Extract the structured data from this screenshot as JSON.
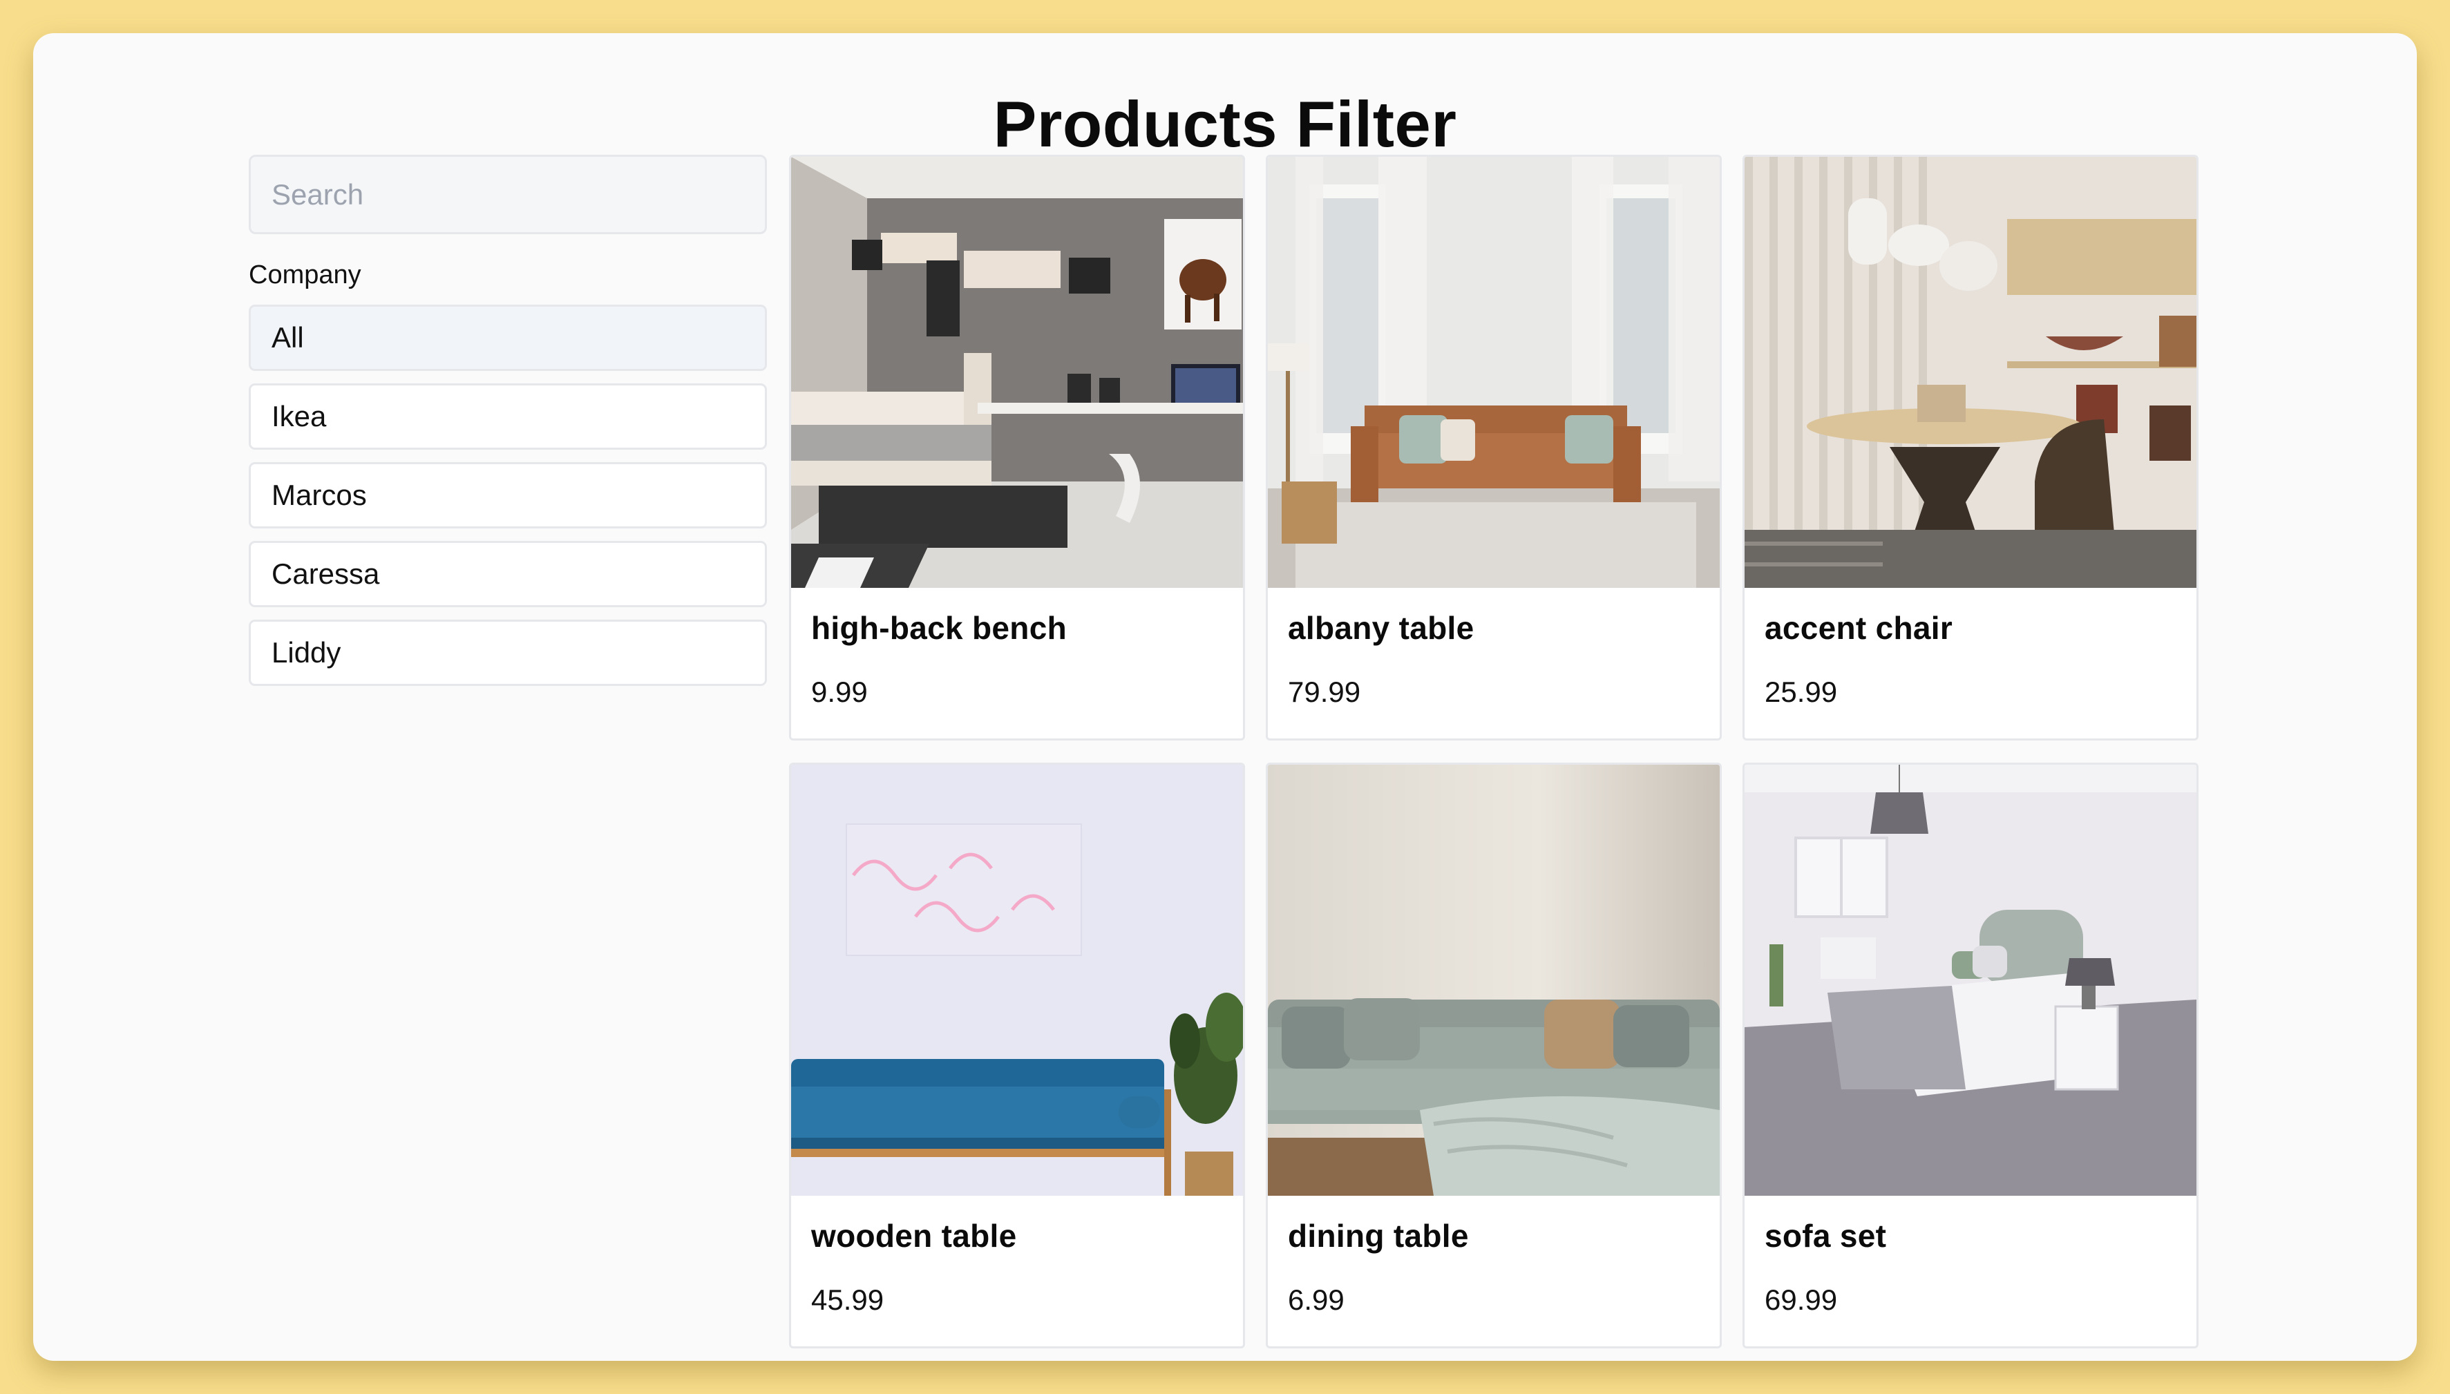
{
  "page": {
    "title": "Products Filter",
    "background": "#f8de8c"
  },
  "sidebar": {
    "search_placeholder": "Search",
    "search_value": "",
    "company_label": "Company",
    "companies": [
      "All",
      "Ikea",
      "Marcos",
      "Caressa",
      "Liddy"
    ],
    "selected": "All"
  },
  "products": [
    {
      "name": "high-back bench",
      "price": "9.99",
      "image": "bedroom-desk-photo"
    },
    {
      "name": "albany table",
      "price": "79.99",
      "image": "leather-sofa-photo"
    },
    {
      "name": "accent chair",
      "price": "25.99",
      "image": "round-table-photo"
    },
    {
      "name": "wooden table",
      "price": "45.99",
      "image": "blue-sofa-neon-photo"
    },
    {
      "name": "dining table",
      "price": "6.99",
      "image": "grey-sofa-photo"
    },
    {
      "name": "sofa set",
      "price": "69.99",
      "image": "white-bedroom-photo"
    }
  ]
}
